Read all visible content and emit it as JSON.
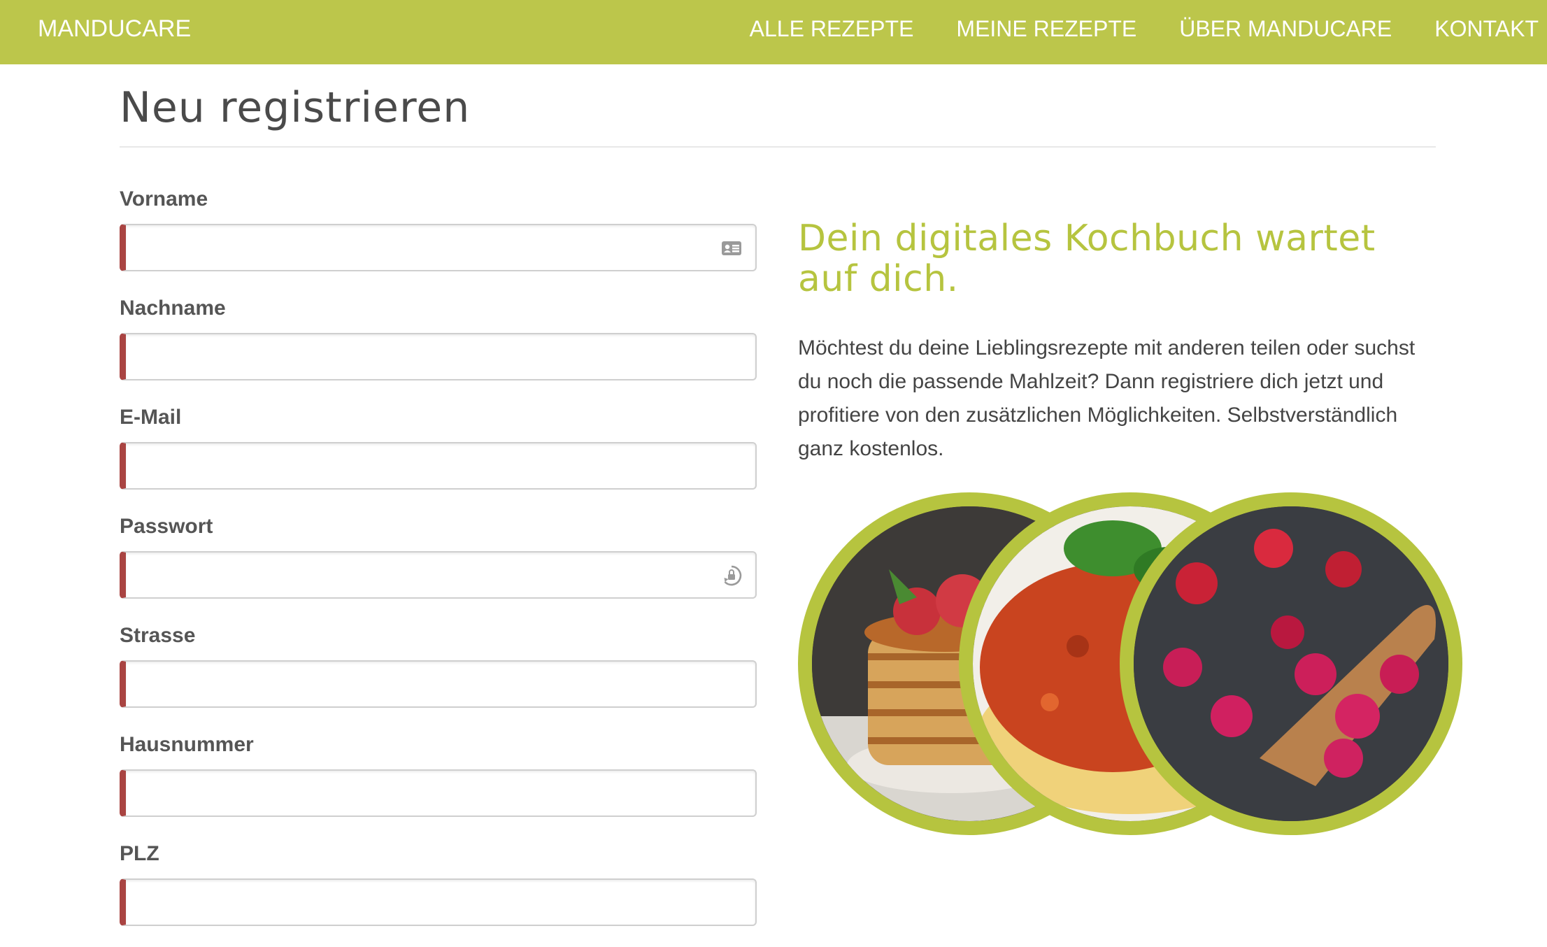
{
  "nav": {
    "brand": "MANDUCARE",
    "links": [
      "ALLE REZEPTE",
      "MEINE REZEPTE",
      "ÜBER MANDUCARE",
      "KONTAKT"
    ]
  },
  "page": {
    "title": "Neu registrieren"
  },
  "form": {
    "fields": [
      {
        "label": "Vorname",
        "value": "",
        "icon": "contact-card-icon"
      },
      {
        "label": "Nachname",
        "value": ""
      },
      {
        "label": "E-Mail",
        "value": ""
      },
      {
        "label": "Passwort",
        "value": "",
        "icon": "password-manager-icon"
      },
      {
        "label": "Strasse",
        "value": ""
      },
      {
        "label": "Hausnummer",
        "value": ""
      },
      {
        "label": "PLZ",
        "value": ""
      }
    ]
  },
  "info": {
    "tagline": "Dein digitales Kochbuch wartet auf dich.",
    "description": "Möchtest du deine Lieblingsrezepte mit anderen teilen oder suchst du noch die passende Mahlzeit? Dann registriere dich jetzt und profitiere von den zusätzlichen Möglichkeiten. Selbstverständlich ganz kostenlos."
  },
  "images": [
    "pancakes-photo",
    "spaghetti-bolognese-photo",
    "berries-photo"
  ],
  "colors": {
    "brand_green": "#bcc64b",
    "accent_green": "#b6c43f",
    "required_marker": "#a94442",
    "text": "#444444"
  }
}
